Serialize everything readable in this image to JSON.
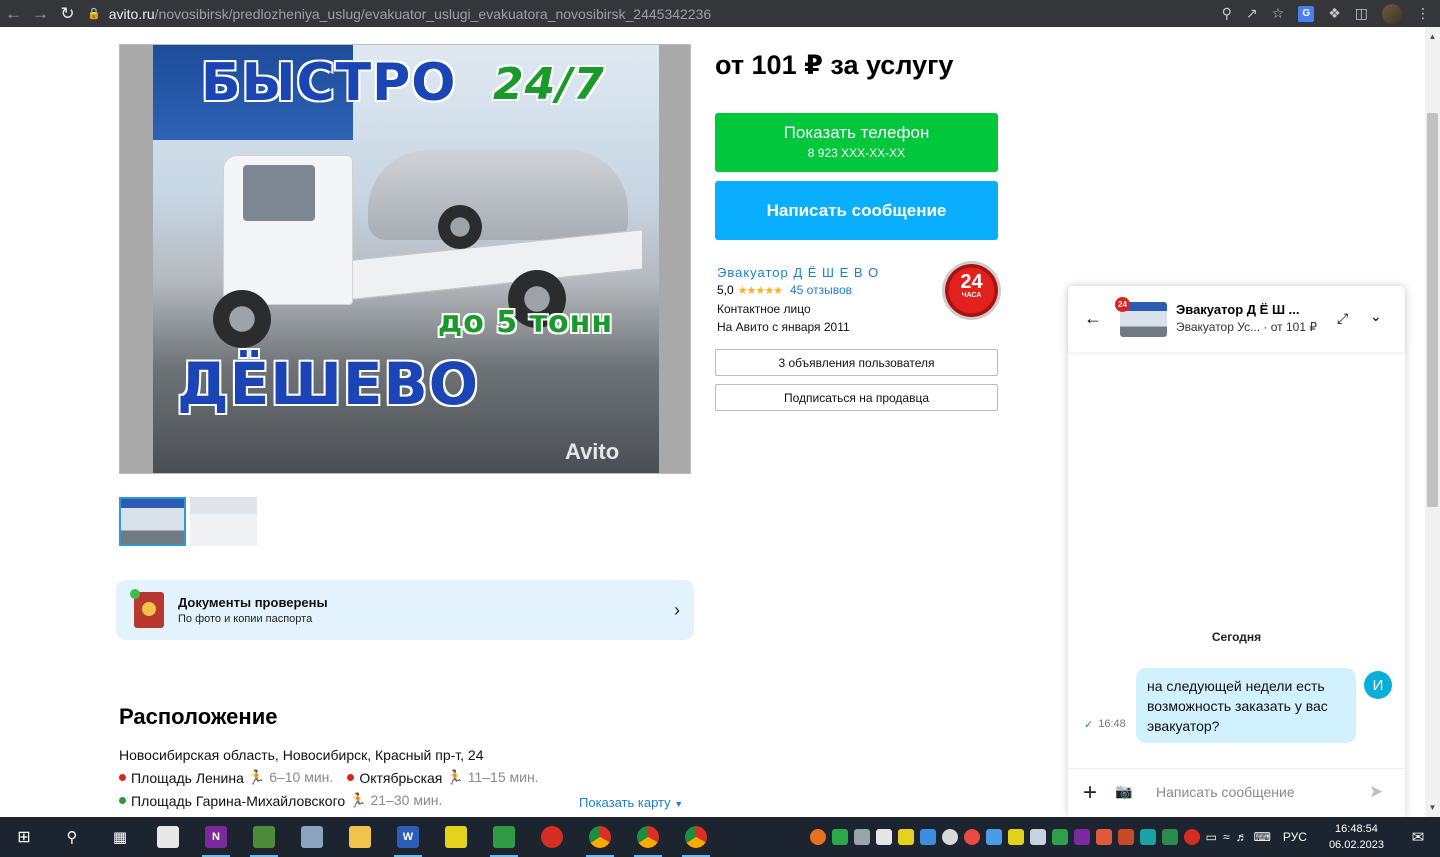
{
  "browser": {
    "url_host": "avito.ru",
    "url_path": "/novosibirsk/predlozheniya_uslug/evakuator_uslugi_evakuatora_novosibirsk_2445342236"
  },
  "gallery": {
    "ad_line1": "БЫСТРО",
    "ad_line2": "24/7",
    "ad_line3": "до 5 тонн",
    "ad_line4": "ДЁШЕВО",
    "watermark": "Avito"
  },
  "documents": {
    "title": "Документы проверены",
    "subtitle": "По фото и копии паспорта"
  },
  "location": {
    "title": "Расположение",
    "address": "Новосибирская область, Новосибирск, Красный пр-т, 24",
    "metro": [
      {
        "name": "Площадь Ленина",
        "time": "6–10 мин.",
        "color": "#d7261e"
      },
      {
        "name": "Октябрьская",
        "time": "11–15 мин.",
        "color": "#d7261e"
      },
      {
        "name": "Площадь Гарина-Михайловского",
        "time": "21–30 мин.",
        "color": "#2c9a3a"
      }
    ],
    "map_link": "Показать карту"
  },
  "listing": {
    "price": "от 101 ₽ за услугу",
    "phone_label": "Показать телефон",
    "phone_masked": "8 923 XXX-XX-XX",
    "message_label": "Написать сообщение"
  },
  "seller": {
    "name": "Эвакуатор Д Ё Ш Е В О",
    "rating": "5,0",
    "reviews": "45 отзывов",
    "contact_type": "Контактное лицо",
    "since": "На Авито с января 2011",
    "badge_number": "24",
    "badge_text": "ЧАСА",
    "listings_button": "3 объявления пользователя",
    "subscribe_button": "Подписаться на продавца"
  },
  "chat": {
    "unread_count": "24",
    "title": "Эвакуатор Д Ё Ш ...",
    "subtitle": "Эвакуатор Ус... · от 101 ₽",
    "day_label": "Сегодня",
    "message_text": "на следующей недели есть возможность заказать у вас эвакуатор?",
    "message_time": "16:48",
    "user_initial": "И",
    "input_placeholder": "Написать сообщение"
  },
  "taskbar": {
    "language": "РУС",
    "time": "16:48:54",
    "date": "06.02.2023"
  }
}
